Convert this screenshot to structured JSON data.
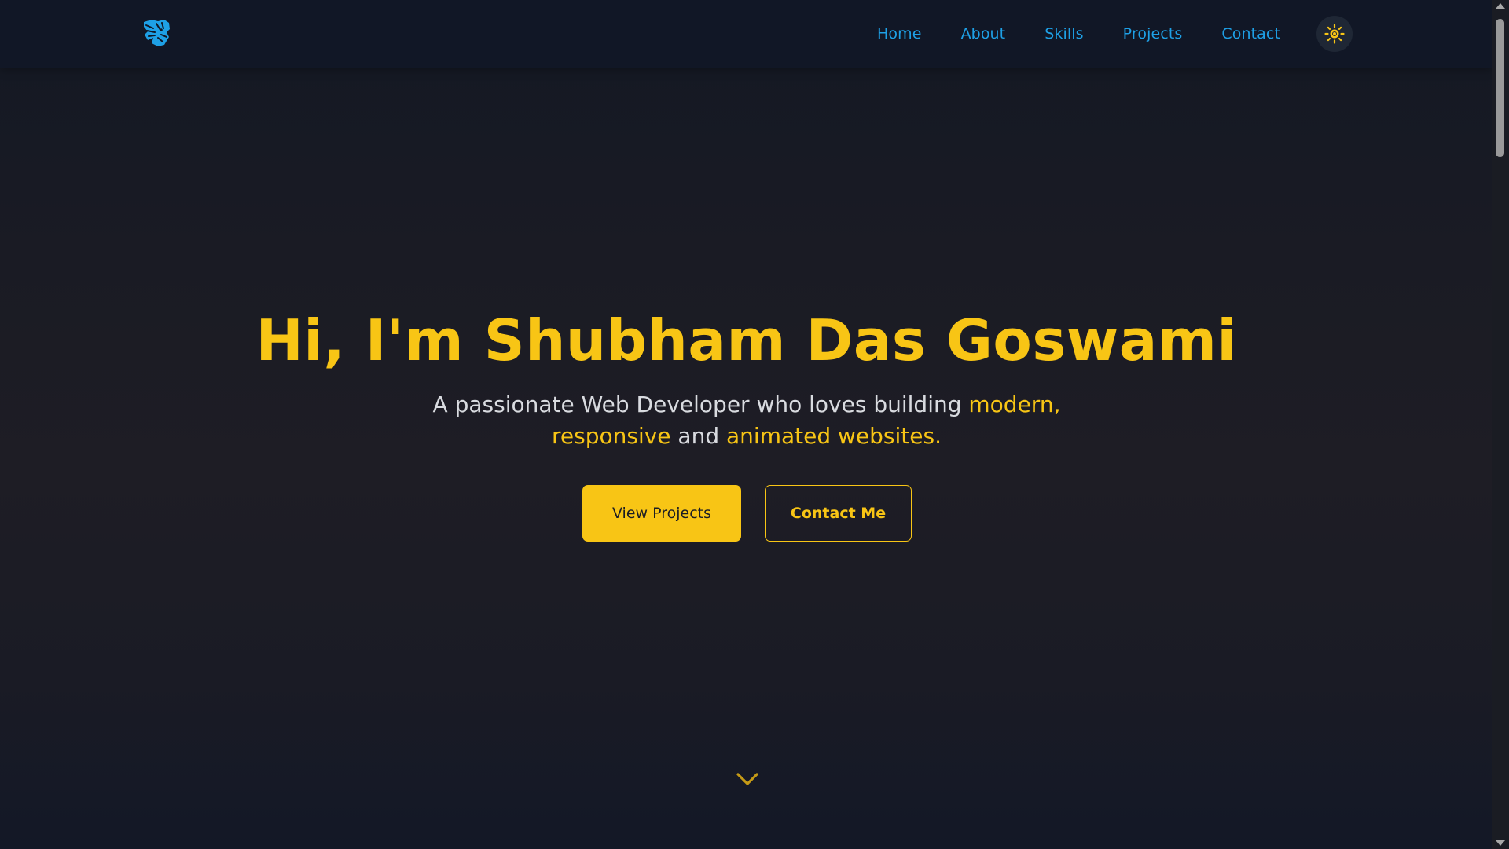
{
  "brand": {
    "logo_icon": "tiger-logo-icon",
    "logo_color": "#1ea0e6"
  },
  "nav": {
    "items": [
      {
        "label": "Home"
      },
      {
        "label": "About"
      },
      {
        "label": "Skills"
      },
      {
        "label": "Projects"
      },
      {
        "label": "Contact"
      }
    ],
    "theme_toggle_icon": "sun-icon",
    "link_color": "#1ea0e6"
  },
  "hero": {
    "title": "Hi, I'm Shubham Das Goswami",
    "subtitle_parts": {
      "p1": "A passionate Web Developer who loves building ",
      "h1": "modern,",
      "h2": "responsive",
      "p2": " and ",
      "h3": "animated websites.",
      "space": " "
    },
    "buttons": {
      "primary": "View Projects",
      "secondary": "Contact Me"
    },
    "scroll_icon": "chevron-down-icon"
  },
  "colors": {
    "accent": "#f8c515",
    "nav_bg": "#111726",
    "text": "#d9dbe0"
  }
}
